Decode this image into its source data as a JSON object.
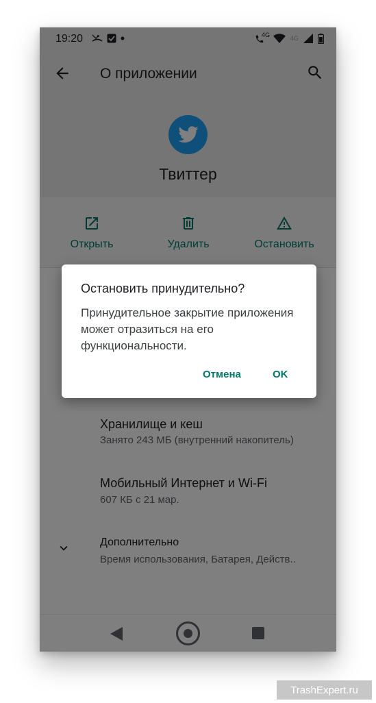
{
  "status_bar": {
    "time": "19:20",
    "icons_left": [
      "missed-call-icon",
      "checkbox-icon",
      "dot-icon"
    ],
    "network_label_1": "4G",
    "network_label_2": "4G",
    "icons_right": [
      "volte-call-icon",
      "wifi-icon",
      "signal-icon",
      "battery-icon"
    ]
  },
  "appbar": {
    "title": "О приложении",
    "back_icon": "arrow-back-icon",
    "search_icon": "search-icon"
  },
  "app": {
    "name": "Твиттер",
    "icon": "twitter-bird-icon",
    "icon_color": "#1da1f2"
  },
  "actions": [
    {
      "label": "Открыть",
      "icon": "open-external-icon"
    },
    {
      "label": "Удалить",
      "icon": "trash-icon"
    },
    {
      "label": "Остановить",
      "icon": "warning-icon"
    }
  ],
  "list": {
    "storage_title": "Хранилище и кеш",
    "storage_sub": "Занято 243 МБ (внутренний накопитель)",
    "data_title": "Мобильный Интернет и Wi-Fi",
    "data_sub": "607 КБ с 21 мар.",
    "advanced_title": "Дополнительно",
    "advanced_sub": "Время использования, Батарея, Действ.."
  },
  "dialog": {
    "title": "Остановить принудительно?",
    "message": "Принудительное закрытие приложения может отразиться на его функциональности.",
    "cancel_label": "Отмена",
    "ok_label": "OK"
  },
  "navbar": {
    "back_icon": "nav-back-icon",
    "home_icon": "nav-home-icon",
    "recents_icon": "nav-recents-icon"
  },
  "watermark": "TrashExpert.ru",
  "colors": {
    "accent": "#00796b",
    "scrim": "rgba(0,0,0,0.5)"
  }
}
